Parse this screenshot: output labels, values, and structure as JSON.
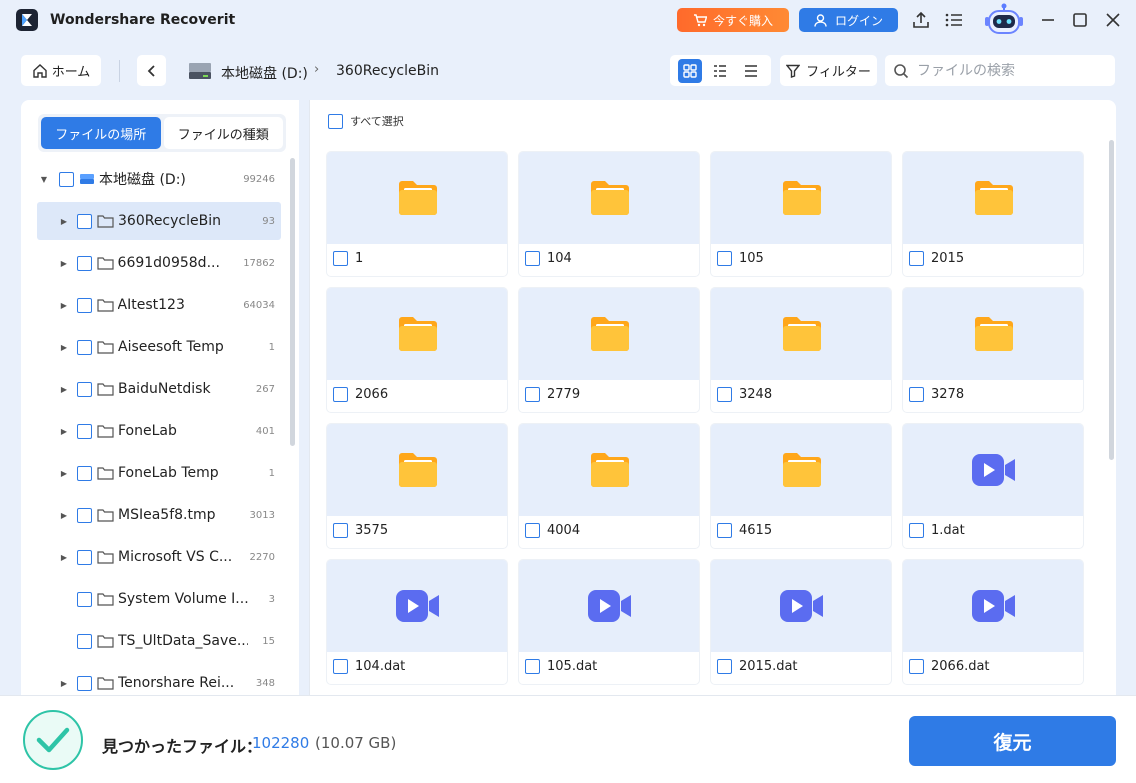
{
  "app": {
    "title": "Wondershare Recoverit"
  },
  "header": {
    "buy_label": "今すぐ購入",
    "login_label": "ログイン",
    "icons": [
      "upload-icon",
      "menu-icon",
      "robot-assistant-icon",
      "minimize-icon",
      "maximize-icon",
      "close-icon"
    ]
  },
  "toolbar": {
    "home_label": "ホーム",
    "breadcrumb": {
      "disk": "本地磁盘 (D:)",
      "separator": "›",
      "folder": "360RecycleBin"
    },
    "filter_label": "フィルター",
    "search_placeholder": "ファイルの検索"
  },
  "sidebar": {
    "tabs": [
      {
        "label": "ファイルの場所",
        "active": true
      },
      {
        "label": "ファイルの種類",
        "active": false
      }
    ],
    "tree": [
      {
        "label": "本地磁盘 (D:)",
        "count": "99246",
        "level": 0,
        "expanded": true,
        "type": "disk",
        "selected": false
      },
      {
        "label": "360RecycleBin",
        "count": "93",
        "level": 1,
        "type": "folder",
        "selected": true,
        "has_children": true
      },
      {
        "label": "6691d0958d...",
        "count": "17862",
        "level": 1,
        "type": "folder",
        "selected": false,
        "has_children": true
      },
      {
        "label": "AItest123",
        "count": "64034",
        "level": 1,
        "type": "folder",
        "selected": false,
        "has_children": true
      },
      {
        "label": "Aiseesoft Temp",
        "count": "1",
        "level": 1,
        "type": "folder",
        "selected": false,
        "has_children": true
      },
      {
        "label": "BaiduNetdisk",
        "count": "267",
        "level": 1,
        "type": "folder",
        "selected": false,
        "has_children": true
      },
      {
        "label": "FoneLab",
        "count": "401",
        "level": 1,
        "type": "folder",
        "selected": false,
        "has_children": true
      },
      {
        "label": "FoneLab Temp",
        "count": "1",
        "level": 1,
        "type": "folder",
        "selected": false,
        "has_children": true
      },
      {
        "label": "MSIea5f8.tmp",
        "count": "3013",
        "level": 1,
        "type": "folder",
        "selected": false,
        "has_children": true
      },
      {
        "label": "Microsoft VS C...",
        "count": "2270",
        "level": 1,
        "type": "folder",
        "selected": false,
        "has_children": true
      },
      {
        "label": "System Volume I...",
        "count": "3",
        "level": 1,
        "type": "folder",
        "selected": false,
        "has_children": false
      },
      {
        "label": "TS_UltData_Save...",
        "count": "15",
        "level": 1,
        "type": "folder",
        "selected": false,
        "has_children": false
      },
      {
        "label": "Tenorshare Rei...",
        "count": "348",
        "level": 1,
        "type": "folder",
        "selected": false,
        "has_children": true
      }
    ]
  },
  "main": {
    "select_all_label": "すべて選択",
    "files": [
      {
        "name": "1",
        "type": "folder"
      },
      {
        "name": "104",
        "type": "folder"
      },
      {
        "name": "105",
        "type": "folder"
      },
      {
        "name": "2015",
        "type": "folder"
      },
      {
        "name": "2066",
        "type": "folder"
      },
      {
        "name": "2779",
        "type": "folder"
      },
      {
        "name": "3248",
        "type": "folder"
      },
      {
        "name": "3278",
        "type": "folder"
      },
      {
        "name": "3575",
        "type": "folder"
      },
      {
        "name": "4004",
        "type": "folder"
      },
      {
        "name": "4615",
        "type": "folder"
      },
      {
        "name": "1.dat",
        "type": "video"
      },
      {
        "name": "104.dat",
        "type": "video"
      },
      {
        "name": "105.dat",
        "type": "video"
      },
      {
        "name": "2015.dat",
        "type": "video"
      },
      {
        "name": "2066.dat",
        "type": "video"
      }
    ]
  },
  "footer": {
    "found_label": "見つかったファイル：",
    "found_count": "102280",
    "found_size": "(10.07 GB)",
    "recover_label": "復元"
  },
  "colors": {
    "accent": "#2f7be6",
    "buy": "#ff7430",
    "folder": "#ffb81f",
    "video": "#5b6cf0",
    "success": "#2ec4a7"
  }
}
